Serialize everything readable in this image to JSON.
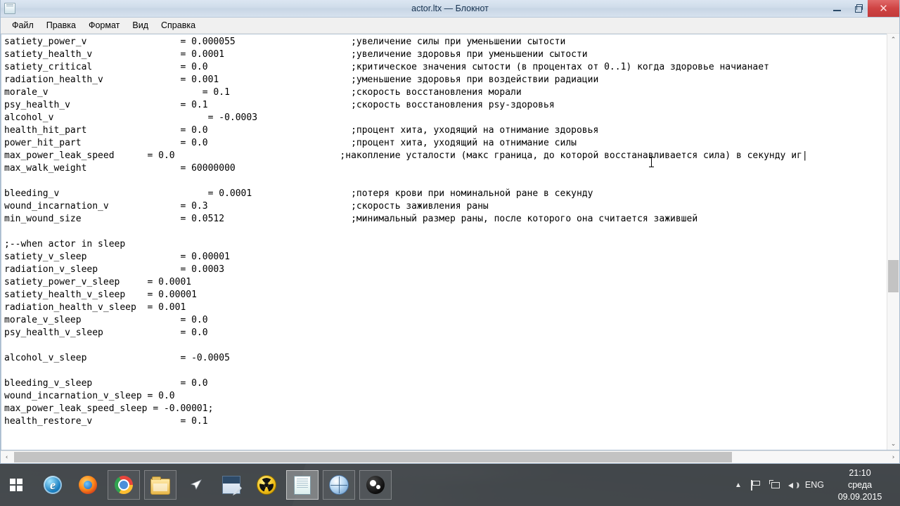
{
  "window": {
    "title": "actor.ltx — Блокнот",
    "icon": "notepad-document-icon",
    "minimize_label": "—",
    "restore_label": "❐",
    "close_label": "✕"
  },
  "menu": {
    "items": [
      {
        "label": "Файл"
      },
      {
        "label": "Правка"
      },
      {
        "label": "Формат"
      },
      {
        "label": "Вид"
      },
      {
        "label": "Справка"
      }
    ]
  },
  "editor": {
    "content": "satiety_power_v                 = 0.000055                     ;увеличение силы при уменьшении сытости\nsatiety_health_v                = 0.0001                       ;увеличение здоровья при уменьшении сытости\nsatiety_critical                = 0.0                          ;критическое значения сытости (в процентах от 0..1) когда здоровье начианает\nradiation_health_v              = 0.001                        ;уменьшение здоровья при воздействии радиации\nmorale_v                            = 0.1                      ;скорость восстановления морали\npsy_health_v                    = 0.1                          ;скорость восстановления psy-здоровья\nalcohol_v                            = -0.0003\nhealth_hit_part                 = 0.0                          ;процент хита, уходящий на отнимание здоровья\npower_hit_part                  = 0.0                          ;процент хита, уходящий на отнимание силы\nmax_power_leak_speed      = 0.0                              ;накопление усталости (макс граница, до которой восстанавливается сила) в секунду иг|\nmax_walk_weight                 = 60000000\n\nbleeding_v                           = 0.0001                  ;потеря крови при номинальной ране в секунду\nwound_incarnation_v             = 0.3                          ;скорость заживления раны\nmin_wound_size                  = 0.0512                       ;минимальный размер раны, после которого она считается зажившей\n\n;--when actor in sleep\nsatiety_v_sleep                 = 0.00001\nradiation_v_sleep               = 0.0003\nsatiety_power_v_sleep     = 0.0001\nsatiety_health_v_sleep    = 0.00001\nradiation_health_v_sleep  = 0.001\nmorale_v_sleep                  = 0.0\npsy_health_v_sleep              = 0.0\n\nalcohol_v_sleep                 = -0.0005\n\nbleeding_v_sleep                = 0.0\nwound_incarnation_v_sleep = 0.0\nmax_power_leak_speed_sleep = -0.00001;\nhealth_restore_v                = 0.1",
    "scrollbars": {
      "up_arrow": "⌃",
      "down_arrow": "⌄",
      "left_arrow": "‹",
      "right_arrow": "›"
    }
  },
  "taskbar": {
    "start_label": "start-button",
    "buttons": [
      {
        "name": "taskbar-item-internet-explorer",
        "icon": "internet-explorer-icon",
        "framed": false,
        "active": false
      },
      {
        "name": "taskbar-item-firefox",
        "icon": "firefox-icon",
        "framed": false,
        "active": false
      },
      {
        "name": "taskbar-item-chrome",
        "icon": "chrome-icon",
        "framed": true,
        "active": false
      },
      {
        "name": "taskbar-item-file-explorer",
        "icon": "folder-icon",
        "framed": true,
        "active": false
      },
      {
        "name": "taskbar-item-cursor-app",
        "icon": "cursor-arrow-icon",
        "framed": false,
        "active": false
      },
      {
        "name": "taskbar-item-editor",
        "icon": "editor-icon",
        "framed": false,
        "active": false
      },
      {
        "name": "taskbar-item-stalker",
        "icon": "radiation-icon",
        "framed": false,
        "active": false
      },
      {
        "name": "taskbar-item-notepad",
        "icon": "notepad-icon",
        "framed": true,
        "active": true
      },
      {
        "name": "taskbar-item-browser",
        "icon": "globe-icon",
        "framed": true,
        "active": false
      },
      {
        "name": "taskbar-item-steam",
        "icon": "steam-icon",
        "framed": true,
        "active": false
      }
    ],
    "tray": {
      "chevron": "▲",
      "flag_icon": "flag-icon",
      "network_icon": "network-icon",
      "speaker_icon": "speaker-icon",
      "language": "ENG",
      "time": "21:10",
      "weekday": "среда",
      "date": "09.09.2015"
    }
  },
  "colors": {
    "titlebar": "#cfdcea",
    "close_button": "#cf4343",
    "editor_bg": "#ffffff",
    "taskbar_bg": "#3e4246",
    "scroll_thumb": "#c3c3c3"
  }
}
